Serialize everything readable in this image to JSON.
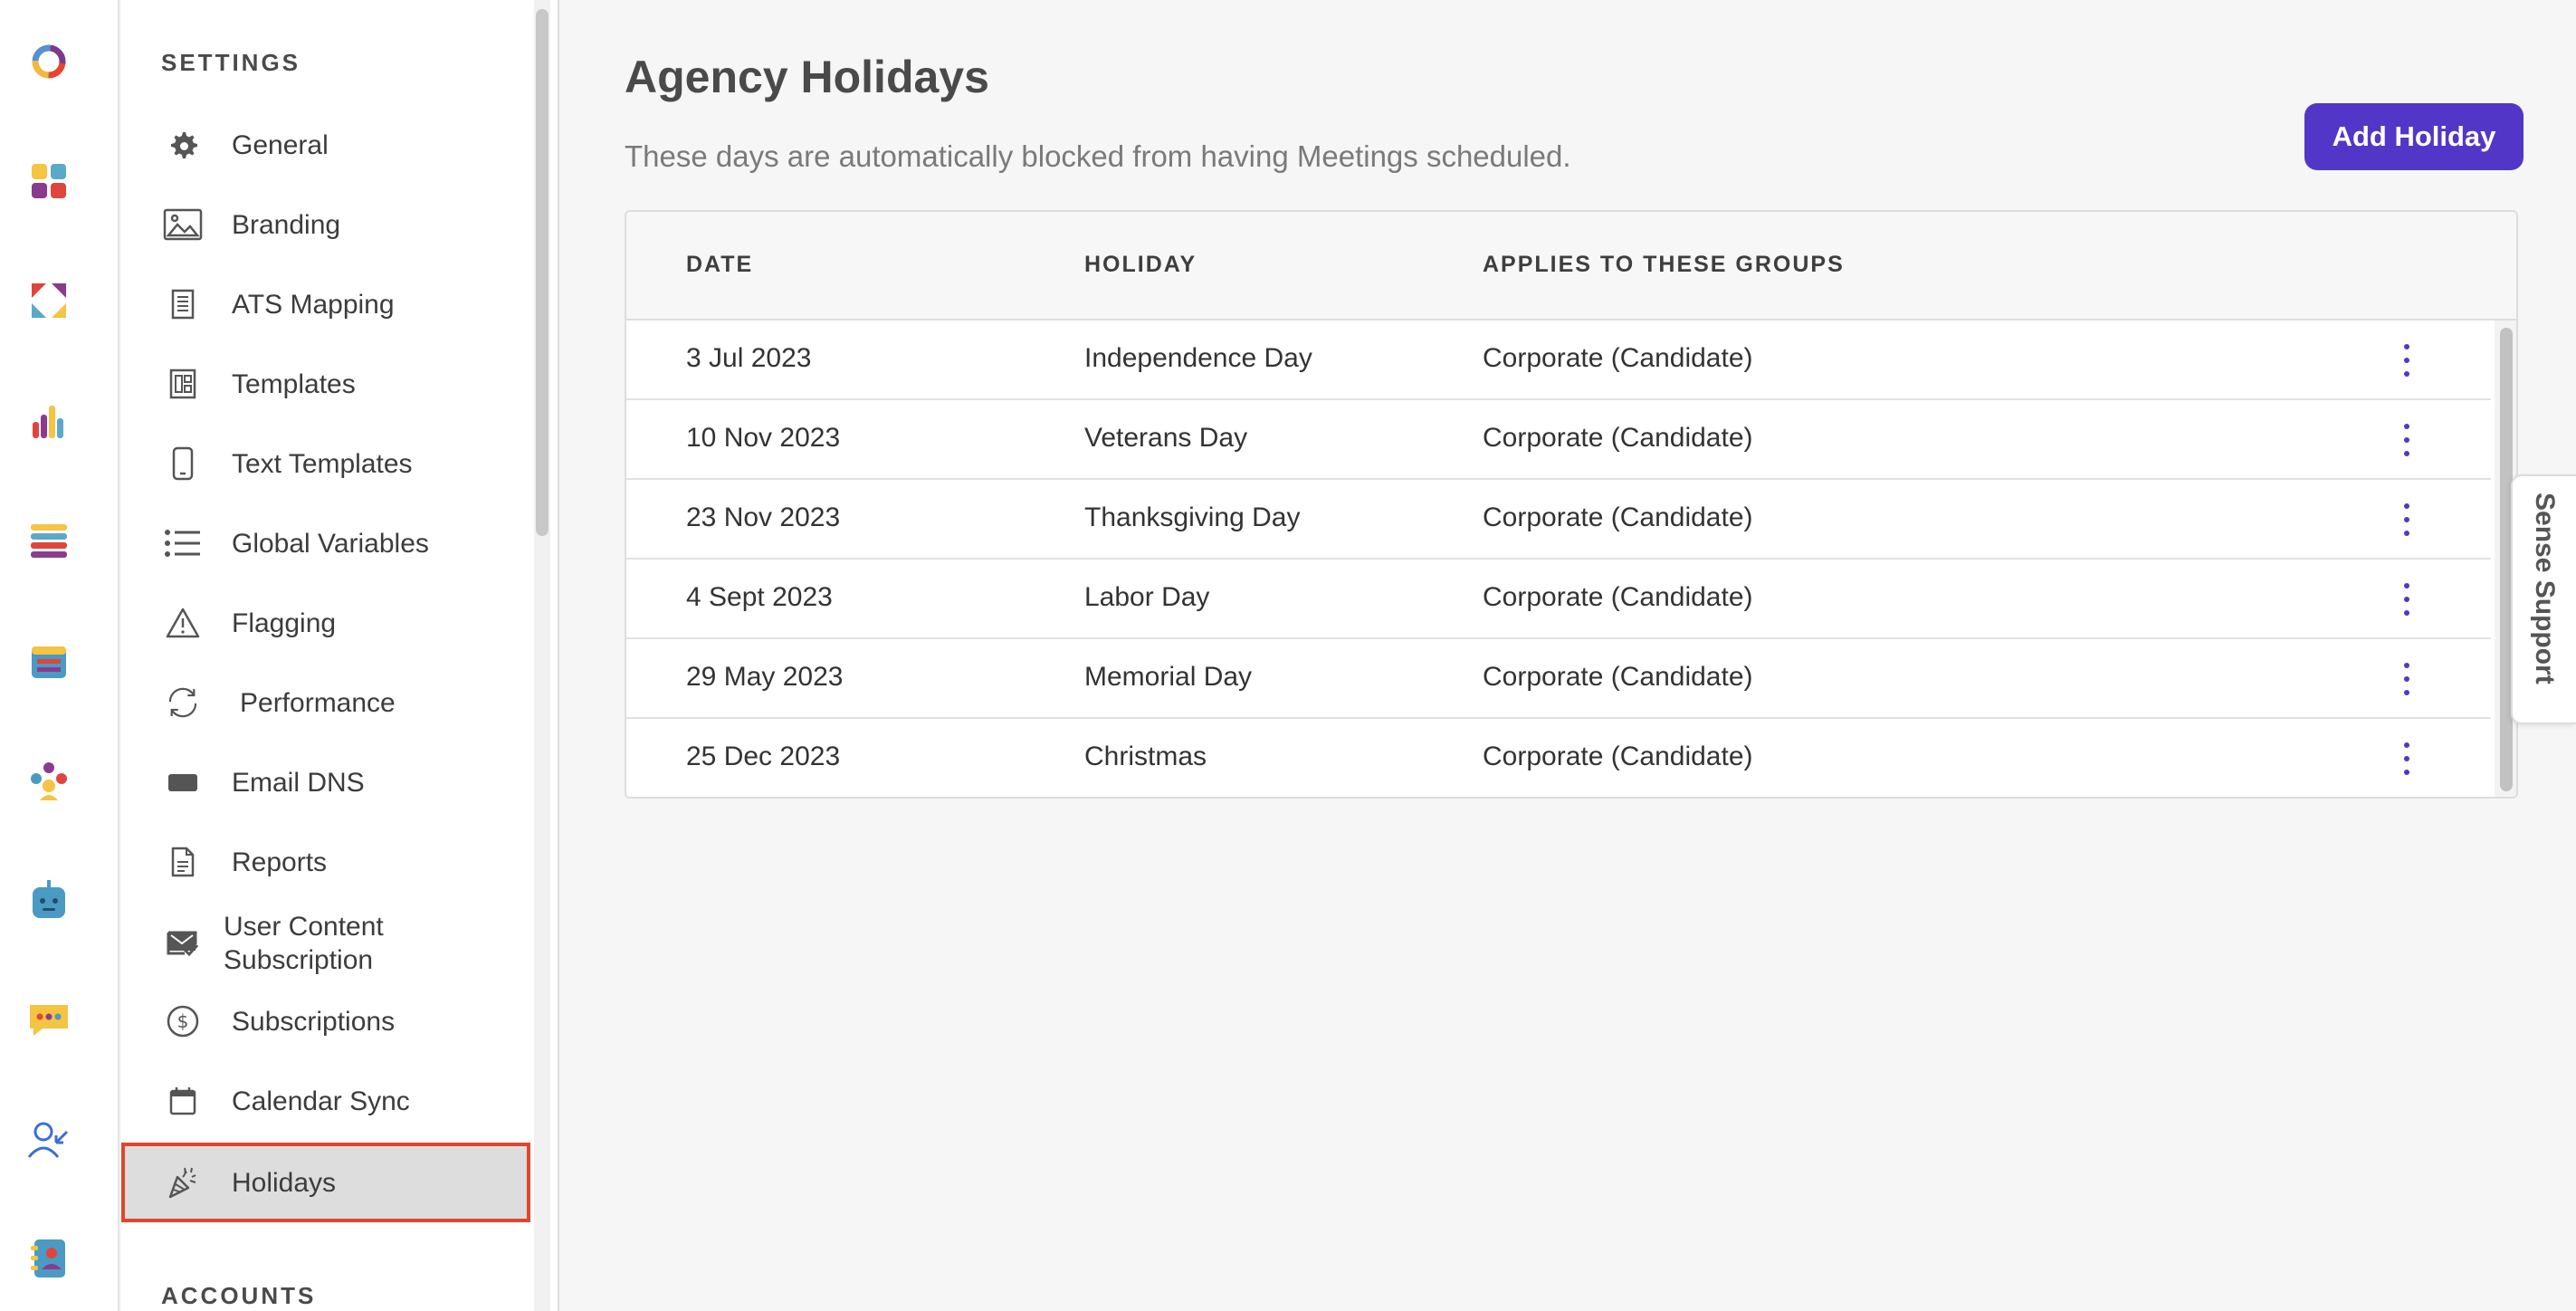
{
  "rail": {
    "icons": [
      "logo-ring-icon",
      "apps-grid-icon",
      "arrows-exchange-icon",
      "bar-chart-icon",
      "list-icon",
      "calendar-icon",
      "people-group-icon",
      "robot-icon",
      "chat-bubble-icon",
      "user-arrow-icon",
      "contact-book-icon"
    ]
  },
  "settings": {
    "section_title": "SETTINGS",
    "items": [
      {
        "label": "General",
        "icon": "gear-icon"
      },
      {
        "label": "Branding",
        "icon": "image-icon"
      },
      {
        "label": "ATS Mapping",
        "icon": "document-list-icon"
      },
      {
        "label": "Templates",
        "icon": "template-icon"
      },
      {
        "label": "Text Templates",
        "icon": "phone-icon"
      },
      {
        "label": "Global Variables",
        "icon": "bullet-list-icon"
      },
      {
        "label": "Flagging",
        "icon": "warning-triangle-icon"
      },
      {
        "label": "Performance",
        "icon": "refresh-icon"
      },
      {
        "label": "Email DNS",
        "icon": "email-block-icon"
      },
      {
        "label": "Reports",
        "icon": "report-icon"
      },
      {
        "label": "User Content Subscription",
        "icon": "mail-check-icon"
      },
      {
        "label": "Subscriptions",
        "icon": "dollar-circle-icon"
      },
      {
        "label": "Calendar Sync",
        "icon": "calendar-sync-icon"
      },
      {
        "label": "Holidays",
        "icon": "party-popper-icon"
      }
    ],
    "accounts_title": "ACCOUNTS"
  },
  "main": {
    "title": "Agency Holidays",
    "subtitle": "These days are automatically blocked from having Meetings scheduled.",
    "add_button": "Add Holiday",
    "table": {
      "headers": [
        "DATE",
        "HOLIDAY",
        "APPLIES TO THESE GROUPS"
      ],
      "rows": [
        {
          "date": "3 Jul 2023",
          "holiday": "Independence Day",
          "groups": "Corporate (Candidate)"
        },
        {
          "date": "10 Nov 2023",
          "holiday": "Veterans Day",
          "groups": "Corporate (Candidate)"
        },
        {
          "date": "23 Nov 2023",
          "holiday": "Thanksgiving Day",
          "groups": "Corporate (Candidate)"
        },
        {
          "date": "4 Sept 2023",
          "holiday": "Labor Day",
          "groups": "Corporate (Candidate)"
        },
        {
          "date": "29 May 2023",
          "holiday": "Memorial Day",
          "groups": "Corporate (Candidate)"
        },
        {
          "date": "25 Dec 2023",
          "holiday": "Christmas",
          "groups": "Corporate (Candidate)"
        }
      ]
    }
  },
  "support_tab": "Sense Support",
  "colors": {
    "accent": "#5236c7",
    "active_outline": "#e0452f"
  }
}
